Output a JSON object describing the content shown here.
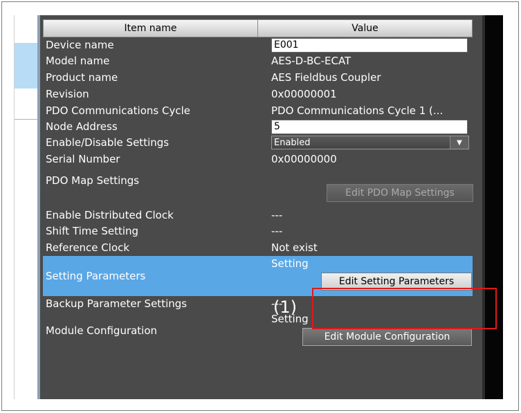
{
  "header": {
    "col_item": "Item name",
    "col_value": "Value"
  },
  "rows": {
    "device_name": {
      "label": "Device name",
      "value": "E001"
    },
    "model_name": {
      "label": "Model name",
      "value": "AES-D-BC-ECAT"
    },
    "product_name": {
      "label": "Product name",
      "value": "AES Fieldbus Coupler"
    },
    "revision": {
      "label": "Revision",
      "value": "0x00000001"
    },
    "pdo_cycle": {
      "label": "PDO Communications Cycle",
      "value": "PDO Communications Cycle 1 (..."
    },
    "node_address": {
      "label": "Node Address",
      "value": "5"
    },
    "enable_disable": {
      "label": "Enable/Disable Settings",
      "value": "Enabled"
    },
    "serial_number": {
      "label": "Serial Number",
      "value": "0x00000000"
    },
    "pdo_map": {
      "label": "PDO Map Settings",
      "button": "Edit PDO Map Settings"
    },
    "dist_clock": {
      "label": "Enable Distributed Clock",
      "value": "---"
    },
    "shift_time": {
      "label": "Shift Time Setting",
      "value": "---"
    },
    "ref_clock": {
      "label": "Reference Clock",
      "value": "Not exist"
    },
    "setting_params": {
      "label": "Setting Parameters",
      "value": "Setting",
      "button": "Edit Setting Parameters"
    },
    "backup_params": {
      "label": "Backup Parameter Settings",
      "value": "---"
    },
    "module_config": {
      "label": "Module Configuration",
      "value": "Setting",
      "button": "Edit Module Configuration"
    }
  },
  "annotation": {
    "number": "(1)",
    "color": "#e11919"
  },
  "colors": {
    "panel": "#4a4a4a",
    "selected": "#5aa7e6"
  }
}
